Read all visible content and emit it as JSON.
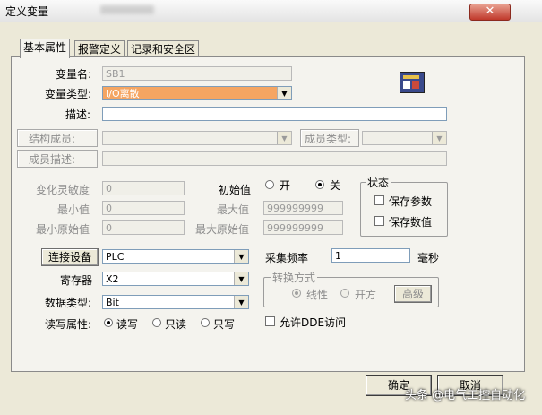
{
  "window": {
    "title": "定义变量",
    "close_glyph": "✕"
  },
  "tabs": [
    {
      "label": "基本属性",
      "active": true
    },
    {
      "label": "报警定义",
      "active": false
    },
    {
      "label": "记录和安全区",
      "active": false
    }
  ],
  "basic": {
    "var_name": {
      "label": "变量名:",
      "value": "SB1"
    },
    "var_type": {
      "label": "变量类型:",
      "value": "I/O离散"
    },
    "description": {
      "label": "描述:",
      "value": ""
    },
    "struct_member": {
      "label": "结构成员:",
      "value": ""
    },
    "member_type": {
      "label": "成员类型:",
      "value": ""
    },
    "member_desc": {
      "label": "成员描述:",
      "value": ""
    }
  },
  "range": {
    "sensitivity": {
      "label": "变化灵敏度",
      "value": "0"
    },
    "min": {
      "label": "最小值",
      "value": "0"
    },
    "min_raw": {
      "label": "最小原始值",
      "value": "0"
    },
    "initial": {
      "label": "初始值",
      "on_label": "开",
      "off_label": "关",
      "selected": "关"
    },
    "max": {
      "label": "最大值",
      "value": "999999999"
    },
    "max_raw": {
      "label": "最大原始值",
      "value": "999999999"
    }
  },
  "status_group": {
    "title": "状态",
    "save_params": {
      "label": "保存参数",
      "checked": false
    },
    "save_values": {
      "label": "保存数值",
      "checked": false
    }
  },
  "io": {
    "device_button": "连接设备",
    "device_value": "PLC",
    "register": {
      "label": "寄存器",
      "value": "X2"
    },
    "data_type": {
      "label": "数据类型:",
      "value": "Bit"
    },
    "rw": {
      "label": "读写属性:",
      "options": [
        "读写",
        "只读",
        "只写"
      ],
      "selected": "读写"
    },
    "sample_rate": {
      "label": "采集频率",
      "value": "1",
      "unit": "毫秒"
    },
    "conversion": {
      "title": "转换方式",
      "options": [
        "线性",
        "开方"
      ],
      "selected": "线性",
      "advanced_label": "高级"
    },
    "dde": {
      "label": "允许DDE访问",
      "checked": false
    }
  },
  "buttons": {
    "ok": "确定",
    "cancel": "取消"
  },
  "watermark": "头条 @电气工控自动化"
}
